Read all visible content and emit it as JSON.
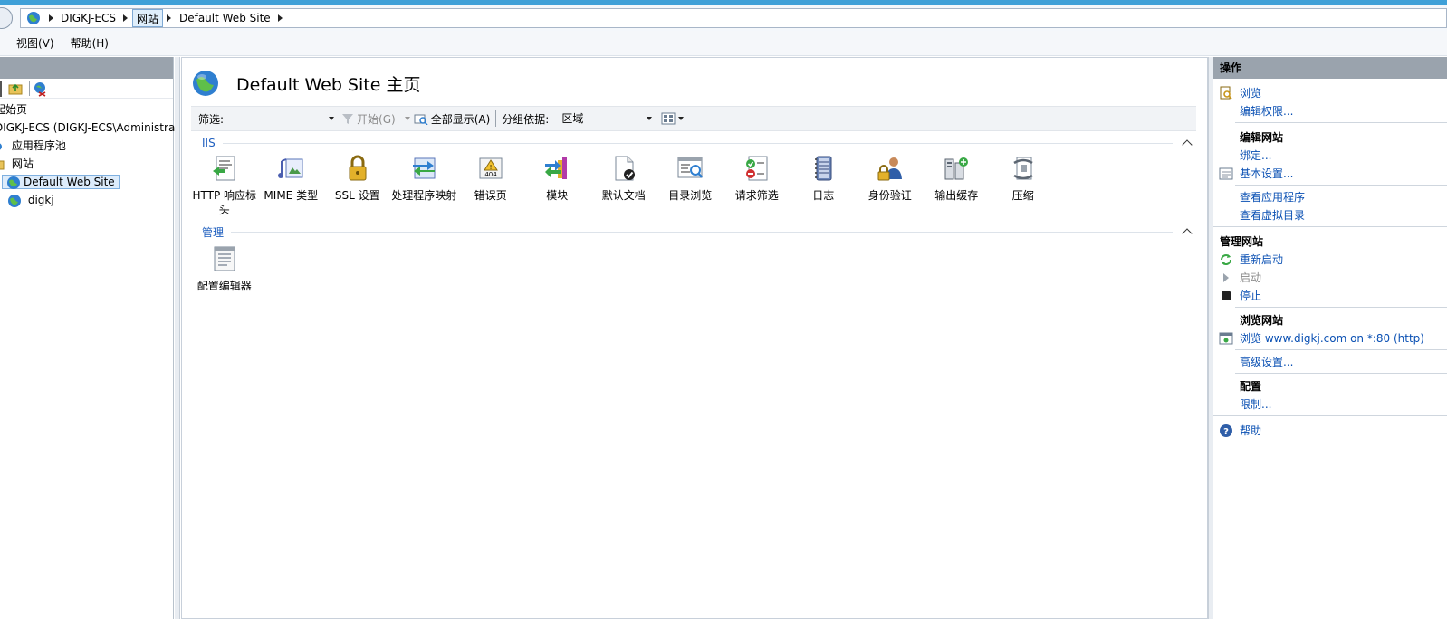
{
  "address_bar": {
    "crumbs": [
      "DIGKJ-ECS",
      "网站",
      "Default Web Site"
    ]
  },
  "menu": [
    "视图(V)",
    "帮助(H)"
  ],
  "tree": {
    "items": [
      {
        "label": "起始页"
      },
      {
        "label": "DIGKJ-ECS (DIGKJ-ECS\\Administrat"
      },
      {
        "label": "应用程序池"
      },
      {
        "label": "网站"
      },
      {
        "label": "Default Web Site"
      },
      {
        "label": "digkj"
      }
    ]
  },
  "main": {
    "title": "Default Web Site 主页",
    "filter": {
      "label": "筛选:",
      "start": "开始(G)",
      "show_all": "全部显示(A)",
      "group_by_label": "分组依据:",
      "group_by_value": "区域"
    },
    "sections": [
      {
        "name": "IIS",
        "items": [
          {
            "label": "HTTP 响应标头",
            "icon": "http-headers-icon"
          },
          {
            "label": "MIME 类型",
            "icon": "mime-types-icon"
          },
          {
            "label": "SSL 设置",
            "icon": "ssl-lock-icon"
          },
          {
            "label": "处理程序映射",
            "icon": "handler-mappings-icon"
          },
          {
            "label": "错误页",
            "icon": "error-pages-icon"
          },
          {
            "label": "模块",
            "icon": "modules-icon"
          },
          {
            "label": "默认文档",
            "icon": "default-document-icon"
          },
          {
            "label": "目录浏览",
            "icon": "directory-browsing-icon"
          },
          {
            "label": "请求筛选",
            "icon": "request-filtering-icon"
          },
          {
            "label": "日志",
            "icon": "logging-icon"
          },
          {
            "label": "身份验证",
            "icon": "authentication-icon"
          },
          {
            "label": "输出缓存",
            "icon": "output-caching-icon"
          },
          {
            "label": "压缩",
            "icon": "compression-icon"
          }
        ]
      },
      {
        "name": "管理",
        "items": [
          {
            "label": "配置编辑器",
            "icon": "configuration-editor-icon"
          }
        ]
      }
    ]
  },
  "actions": {
    "header": "操作",
    "browse": "浏览",
    "edit_permissions": "编辑权限...",
    "edit_site_title": "编辑网站",
    "bindings": "绑定...",
    "basic_settings": "基本设置...",
    "view_apps": "查看应用程序",
    "view_vdirs": "查看虚拟目录",
    "manage_site_title": "管理网站",
    "restart": "重新启动",
    "start": "启动",
    "stop": "停止",
    "browse_site_title": "浏览网站",
    "browse_url": "浏览 www.digkj.com on *:80 (http)",
    "advanced_settings": "高级设置...",
    "config_title": "配置",
    "limits": "限制...",
    "help": "帮助"
  },
  "colors": {
    "link": "#0a50b3",
    "section_header": "#1f5fbf",
    "pane_header": "#9aa3ad",
    "selection": "#ddecfb"
  }
}
